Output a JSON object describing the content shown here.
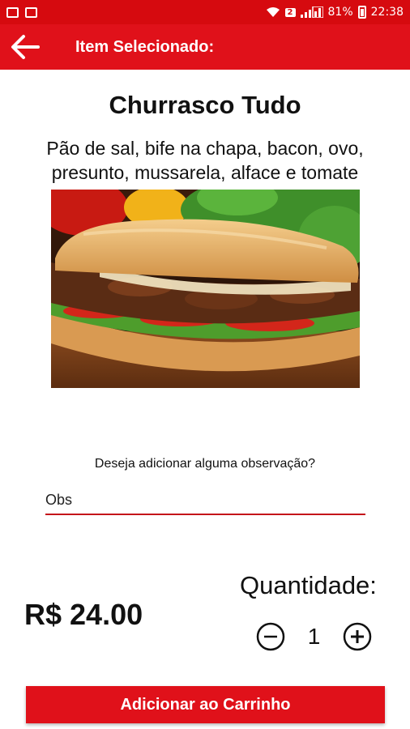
{
  "status_bar": {
    "sim_badge": "2",
    "battery": "81%",
    "time": "22:38"
  },
  "app_bar": {
    "title": "Item Selecionado:"
  },
  "item": {
    "name": "Churrasco Tudo",
    "description": "Pão de sal, bife na chapa, bacon, ovo, presunto, mussarela, alface e tomate",
    "price": "R$ 24.00"
  },
  "observation": {
    "question": "Deseja adicionar alguma observação?",
    "placeholder": "Obs"
  },
  "quantity": {
    "label": "Quantidade:",
    "value": "1"
  },
  "cart_button": {
    "label": "Adicionar ao Carrinho"
  },
  "colors": {
    "status_bar": "#d60a0f",
    "accent": "#e0111a",
    "input_underline": "#c4141a"
  },
  "icons": {
    "back": "arrow-left-icon",
    "decrease": "minus-circle-icon",
    "increase": "plus-circle-icon"
  }
}
